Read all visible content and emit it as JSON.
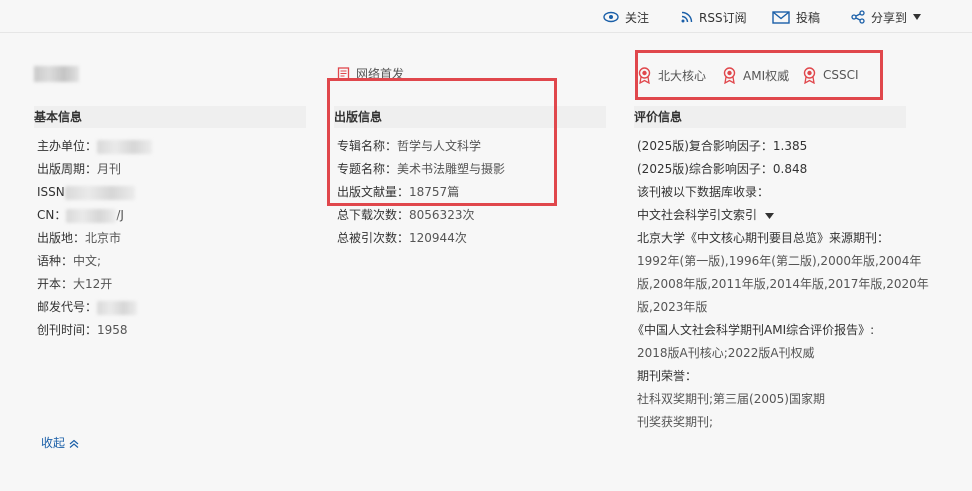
{
  "toolbar": {
    "follow": "关注",
    "rss": "RSS订阅",
    "submit": "投稿",
    "share": "分享到"
  },
  "left": {
    "section_title": "基本信息",
    "rows": [
      {
        "label": "主办单位：",
        "value": ""
      },
      {
        "label": "出版周期：",
        "value": "月刊"
      },
      {
        "label": "ISSN",
        "value": ""
      },
      {
        "label": "CN：",
        "value": "/J"
      },
      {
        "label": "出版地：",
        "value": "北京市"
      },
      {
        "label": "语种：",
        "value": "中文;"
      },
      {
        "label": "开本：",
        "value": "大12开"
      },
      {
        "label": "邮发代号：",
        "value": ""
      },
      {
        "label": "创刊时间：",
        "value": "1958"
      }
    ],
    "collapse": "收起"
  },
  "middle": {
    "network_first": "网络首发",
    "section_title": "出版信息",
    "rows": [
      {
        "label": "专辑名称：",
        "value": "哲学与人文科学"
      },
      {
        "label": "专题名称：",
        "value": "美术书法雕塑与摄影"
      },
      {
        "label": "出版文献量：",
        "value": "18757篇"
      },
      {
        "label": "总下载次数：",
        "value": "8056323次"
      },
      {
        "label": "总被引次数：",
        "value": "120944次"
      }
    ]
  },
  "right": {
    "badges": [
      "北大核心",
      "AMI权威",
      "CSSCI"
    ],
    "section_title": "评价信息",
    "impact1": "(2025版)复合影响因子：1.385",
    "impact2": "(2025版)综合影响因子：0.848",
    "db_label": "该刊被以下数据库收录：",
    "db_name": "中文社会科学引文索引",
    "pku_label": "北京大学《中文核心期刊要目总览》来源期刊：",
    "pku_years": [
      "1992年(第一版),1996年(第二版),2000年版,2004年",
      "版,2008年版,2011年版,2014年版,2017年版,2020年",
      "版,2023年版"
    ],
    "ami_label": "《中国人文社会科学期刊AMI综合评价报告》:",
    "ami_value": "2018版A刊核心;2022版A刊权威",
    "honor_label": "期刊荣誉：",
    "honor_lines": [
      "社科双奖期刊;第三届(2005)国家期",
      "刊奖获奖期刊;"
    ]
  },
  "colors": {
    "accent": "#1a5fa8",
    "highlight": "#e0474c",
    "badge": "#e0474c"
  }
}
